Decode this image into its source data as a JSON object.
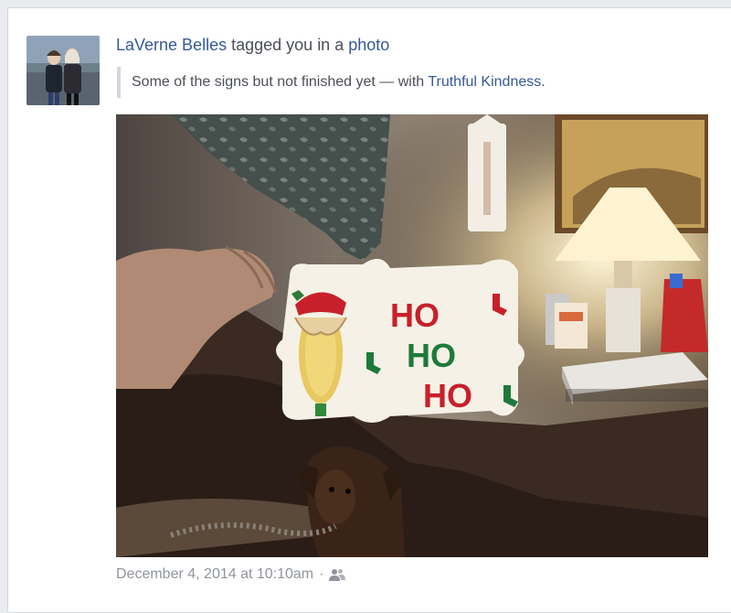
{
  "story": {
    "actor_name": "LaVerne Belles",
    "action_text": "tagged you in a",
    "object_link": "photo",
    "caption_text": "Some of the signs but not finished yet — with",
    "tagged_friend": "Truthful Kindness",
    "caption_end": ".",
    "timestamp": "December 4, 2014 at 10:10am",
    "separator": "·"
  },
  "photo": {
    "sign_text": [
      "HO",
      "HO",
      "HO"
    ]
  },
  "icons": {
    "audience": "friends-icon"
  },
  "colors": {
    "link": "#365899",
    "text": "#4b4f56",
    "muted": "#90949c",
    "sign_red": "#c8202a",
    "sign_green": "#1e7a3a"
  }
}
